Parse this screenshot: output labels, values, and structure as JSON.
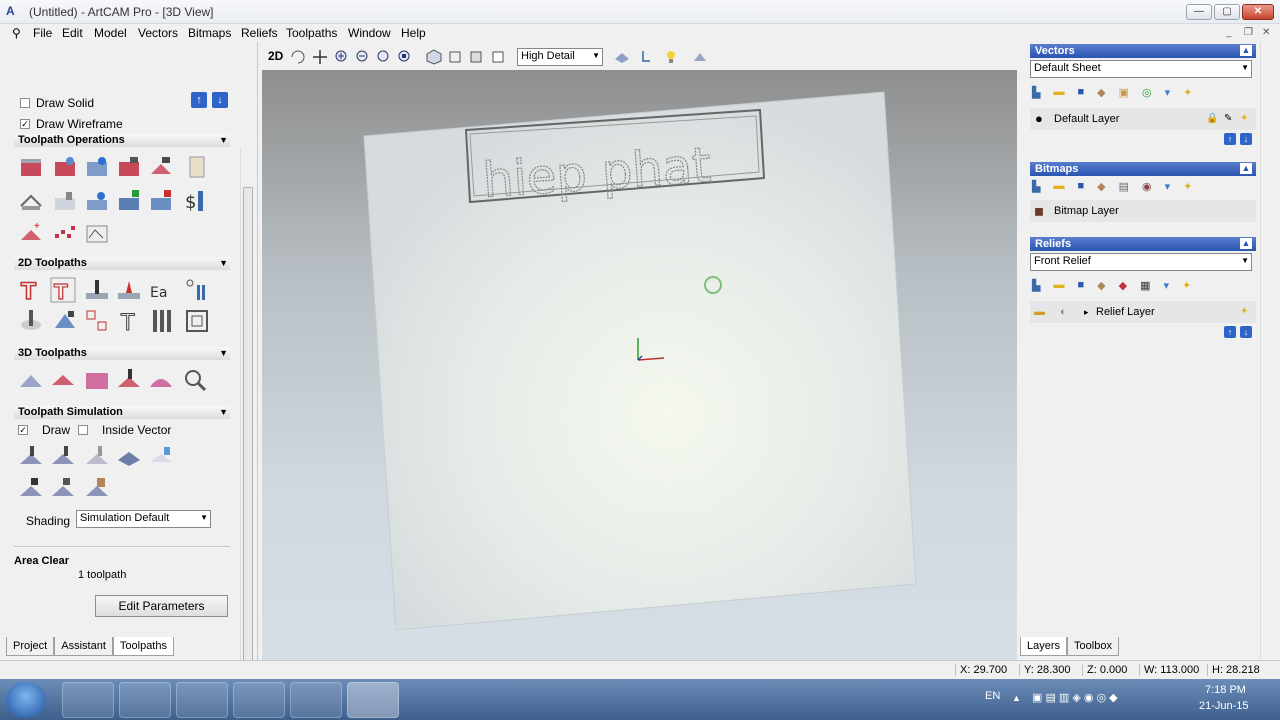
{
  "window": {
    "title": "(Untitled) - ArtCAM Pro - [3D View]",
    "min": "—",
    "max": "▢",
    "close": "✕"
  },
  "menu": [
    "File",
    "Edit",
    "Model",
    "Vectors",
    "Bitmaps",
    "Reliefs",
    "Toolpaths",
    "Window",
    "Help"
  ],
  "left": {
    "draw_solid": "Draw Solid",
    "draw_wireframe": "Draw Wireframe",
    "toolpath_operations": "Toolpath Operations",
    "toolpaths_2d": "2D Toolpaths",
    "toolpaths_3d": "3D Toolpaths",
    "toolpath_simulation": "Toolpath Simulation",
    "draw": "Draw",
    "inside_vector": "Inside Vector",
    "shading": "Shading",
    "shading_value": "Simulation Default",
    "area_clear": "Area Clear",
    "toolpath_count": "1 toolpath",
    "edit_parameters": "Edit Parameters",
    "tabs": [
      "Project",
      "Assistant",
      "Toolpaths"
    ]
  },
  "viewbar": {
    "mode_2d": "2D",
    "detail": "High Detail"
  },
  "viewport": {
    "relief_text": "hiep phat"
  },
  "right": {
    "vectors": "Vectors",
    "vector_sheet": "Default Sheet",
    "default_layer": "Default Layer",
    "bitmaps": "Bitmaps",
    "bitmap_layer": "Bitmap Layer",
    "reliefs": "Reliefs",
    "relief_select": "Front Relief",
    "relief_layer": "Relief Layer",
    "tabs": [
      "Layers",
      "Toolbox"
    ]
  },
  "status": {
    "x": "X: 29.700",
    "y": "Y: 28.300",
    "z": "Z: 0.000",
    "w": "W: 113.000",
    "h": "H: 28.218"
  },
  "taskbar": {
    "lang": "EN",
    "time": "7:18 PM",
    "date": "21-Jun-15"
  }
}
